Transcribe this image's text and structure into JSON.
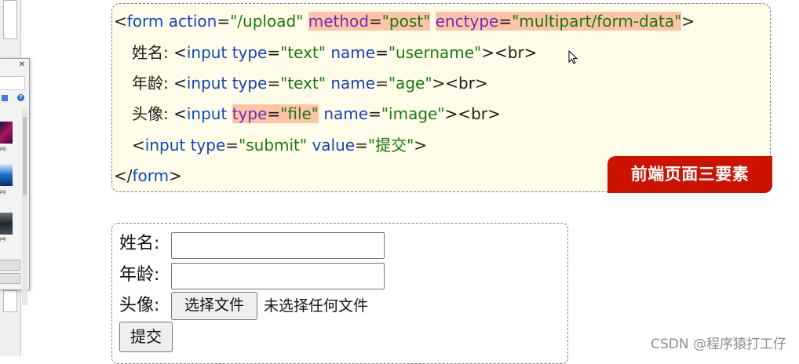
{
  "code_block": {
    "line1": {
      "open": "<",
      "tag": "form",
      "attr1": "action",
      "val1": "\"/upload\"",
      "attr2": "method",
      "val2": "\"post\"",
      "attr3": "enctype",
      "val3": "\"multipart/form-data\"",
      "close": ">"
    },
    "line2": {
      "label": "姓名: ",
      "open": "<",
      "tag": "input",
      "attr1": "type",
      "val1": "\"text\"",
      "attr2": "name",
      "val2": "\"username\"",
      "br": "><br>"
    },
    "line3": {
      "label": "年龄: ",
      "open": "<",
      "tag": "input",
      "attr1": "type",
      "val1": "\"text\"",
      "attr2": "name",
      "val2": "\"age\"",
      "br": "><br>"
    },
    "line4": {
      "label": "头像: ",
      "open": "<",
      "tag": "input",
      "attr1": "type",
      "val1": "\"file\"",
      "attr2": "name",
      "val2": "\"image\"",
      "br": "><br>"
    },
    "line5": {
      "open": "<",
      "tag": "input",
      "attr1": "type",
      "val1": "\"submit\"",
      "attr2": "value",
      "val2": "\"提交\"",
      "close": ">"
    },
    "line6": {
      "open": "</",
      "tag": "form",
      "close": ">"
    },
    "badge": "前端页面三要素"
  },
  "rendered_form": {
    "username_label": "姓名:",
    "age_label": "年龄:",
    "image_label": "头像:",
    "file_button": "选择文件",
    "file_status": "未选择任何文件",
    "submit_button": "提交"
  },
  "watermark": "CSDN @程序猿打工仔",
  "colors": {
    "code_background": "#fffde9",
    "highlight": "#ffc4a8",
    "badge": "#cc1200",
    "tag_name": "#0b4db7",
    "attribute": "#1a3fbf",
    "string": "#157a15"
  }
}
